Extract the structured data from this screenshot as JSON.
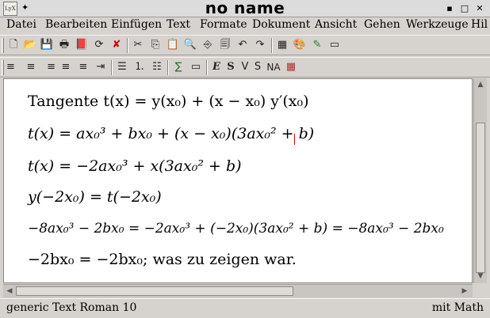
{
  "window": {
    "title": "no name",
    "app_icon_label": "LyX",
    "pin_symbol": "✦",
    "buttons": {
      "minimize": "▪",
      "maximize": "□",
      "close": "✕"
    }
  },
  "menubar": {
    "items": [
      "Datei",
      "Bearbeiten",
      "Einfügen",
      "Text",
      "Formate",
      "Dokument",
      "Ansicht",
      "Gehen",
      "Werkzeuge",
      "Hil"
    ]
  },
  "toolbar1": {
    "icons": [
      {
        "name": "new-document-icon",
        "glyph": "🗋"
      },
      {
        "name": "open-document-icon",
        "glyph": "📂"
      },
      {
        "name": "save-icon",
        "glyph": "💾"
      },
      {
        "name": "print-icon",
        "glyph": "🖶"
      },
      {
        "name": "view-dvi-icon",
        "glyph": "📕"
      },
      {
        "name": "update-icon",
        "glyph": "⟳"
      },
      {
        "name": "close-document-icon",
        "glyph": "✘"
      },
      {
        "name": "cut-icon",
        "glyph": "✂"
      },
      {
        "name": "copy-icon",
        "glyph": "⎘"
      },
      {
        "name": "paste-icon",
        "glyph": "📋"
      },
      {
        "name": "find-icon",
        "glyph": "🔍"
      },
      {
        "name": "find-replace-icon",
        "glyph": "⎆"
      },
      {
        "name": "view-icon",
        "glyph": "🗐"
      },
      {
        "name": "undo-icon",
        "glyph": "↶"
      },
      {
        "name": "redo-icon",
        "glyph": "↷"
      },
      {
        "name": "table-icon",
        "glyph": "▦"
      },
      {
        "name": "figure-icon",
        "glyph": "🎨"
      },
      {
        "name": "spellcheck-icon",
        "glyph": "✎"
      },
      {
        "name": "fullscreen-icon",
        "glyph": "▭"
      }
    ]
  },
  "toolbar2": {
    "icons": [
      {
        "name": "align-left-icon",
        "glyph": "≡"
      },
      {
        "name": "align-center-icon",
        "glyph": "≡"
      },
      {
        "name": "align-right-icon",
        "glyph": "≡"
      },
      {
        "name": "align-block-icon",
        "glyph": "≡"
      },
      {
        "name": "align-default-icon",
        "glyph": "≡"
      },
      {
        "name": "indent-icon",
        "glyph": "⇥"
      },
      {
        "name": "itemize-icon",
        "glyph": "☰"
      },
      {
        "name": "enumerate-icon",
        "glyph": "⒈"
      },
      {
        "name": "description-icon",
        "glyph": "☷"
      },
      {
        "name": "insert-math-icon",
        "glyph": "∑"
      },
      {
        "name": "display-math-icon",
        "glyph": "▭"
      },
      {
        "name": "emph-icon",
        "glyph": "E"
      },
      {
        "name": "bold-icon",
        "glyph": "S"
      },
      {
        "name": "noun-icon",
        "glyph": "V"
      },
      {
        "name": "sans-icon",
        "glyph": "S"
      },
      {
        "name": "font-size-icon",
        "glyph": "NA"
      },
      {
        "name": "color-icon",
        "glyph": "▦"
      }
    ]
  },
  "document": {
    "lines": [
      "Tangente t(x) = y(x₀) + (x − x₀) y′(x₀)",
      "t(x) = ax₀³ + bx₀ + (x − x₀)(3ax₀² + b)",
      "t(x) = −2ax₀³ + x(3ax₀² + b)",
      "y(−2x₀) = t(−2x₀)",
      "−8ax₀³ − 2bx₀ = −2ax₀³ + (−2x₀)(3ax₀² + b) = −8ax₀³ − 2bx₀",
      "−2bx₀ = −2bx₀;  was zu zeigen war."
    ]
  },
  "scroll": {
    "up": "▲",
    "down": "▼",
    "left": "◀",
    "right": "▶"
  },
  "statusbar": {
    "left": "generic Text Roman 10",
    "right": "mit Math"
  },
  "colors": {
    "cursor": "#dd0000",
    "chrome": "#d6d2ce",
    "paper": "#ffffff"
  }
}
